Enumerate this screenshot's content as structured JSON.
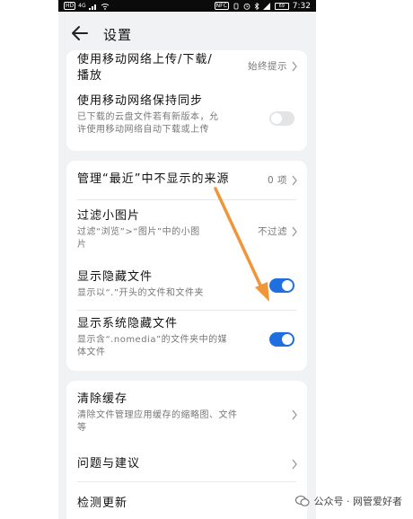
{
  "status_bar": {
    "left_chip": "HD",
    "signal": "4G",
    "right_chip": "NFC",
    "battery": "69",
    "time": "7:32"
  },
  "header": {
    "title": "设置"
  },
  "card1": {
    "row1": {
      "title_l1": "使用移动网络上传/下载/",
      "title_l2": "播放",
      "value": "始终提示"
    },
    "row2": {
      "title": "使用移动网络保持同步",
      "sub_l1": "已下载的云盘文件若有新版本，允",
      "sub_l2": "许使用移动网络自动下载或上传",
      "toggle_on": false
    }
  },
  "card2": {
    "row1": {
      "title": "管理“最近”中不显示的来源",
      "value": "0 项"
    },
    "row2": {
      "title": "过滤小图片",
      "sub_l1": "过滤“浏览”>“图片”中的小图",
      "sub_l2": "片",
      "value": "不过滤"
    },
    "row3": {
      "title": "显示隐藏文件",
      "sub": "显示以“.”开头的文件和文件夹",
      "toggle_on": true
    },
    "row4": {
      "title": "显示系统隐藏文件",
      "sub_l1": "显示含“.nomedia”的文件夹中的媒",
      "sub_l2": "体文件",
      "toggle_on": true
    }
  },
  "card3": {
    "row1": {
      "title": "清除缓存",
      "sub_l1": "清除文件管理应用缓存的缩略图、文件",
      "sub_l2": "等"
    },
    "row2": {
      "title": "问题与建议"
    },
    "row3": {
      "title": "检测更新"
    }
  },
  "watermark": {
    "text": "公众号 · 网管爱好者"
  },
  "colors": {
    "toggle_on": "#1f6fe0",
    "annotation_arrow": "#f0953a"
  }
}
